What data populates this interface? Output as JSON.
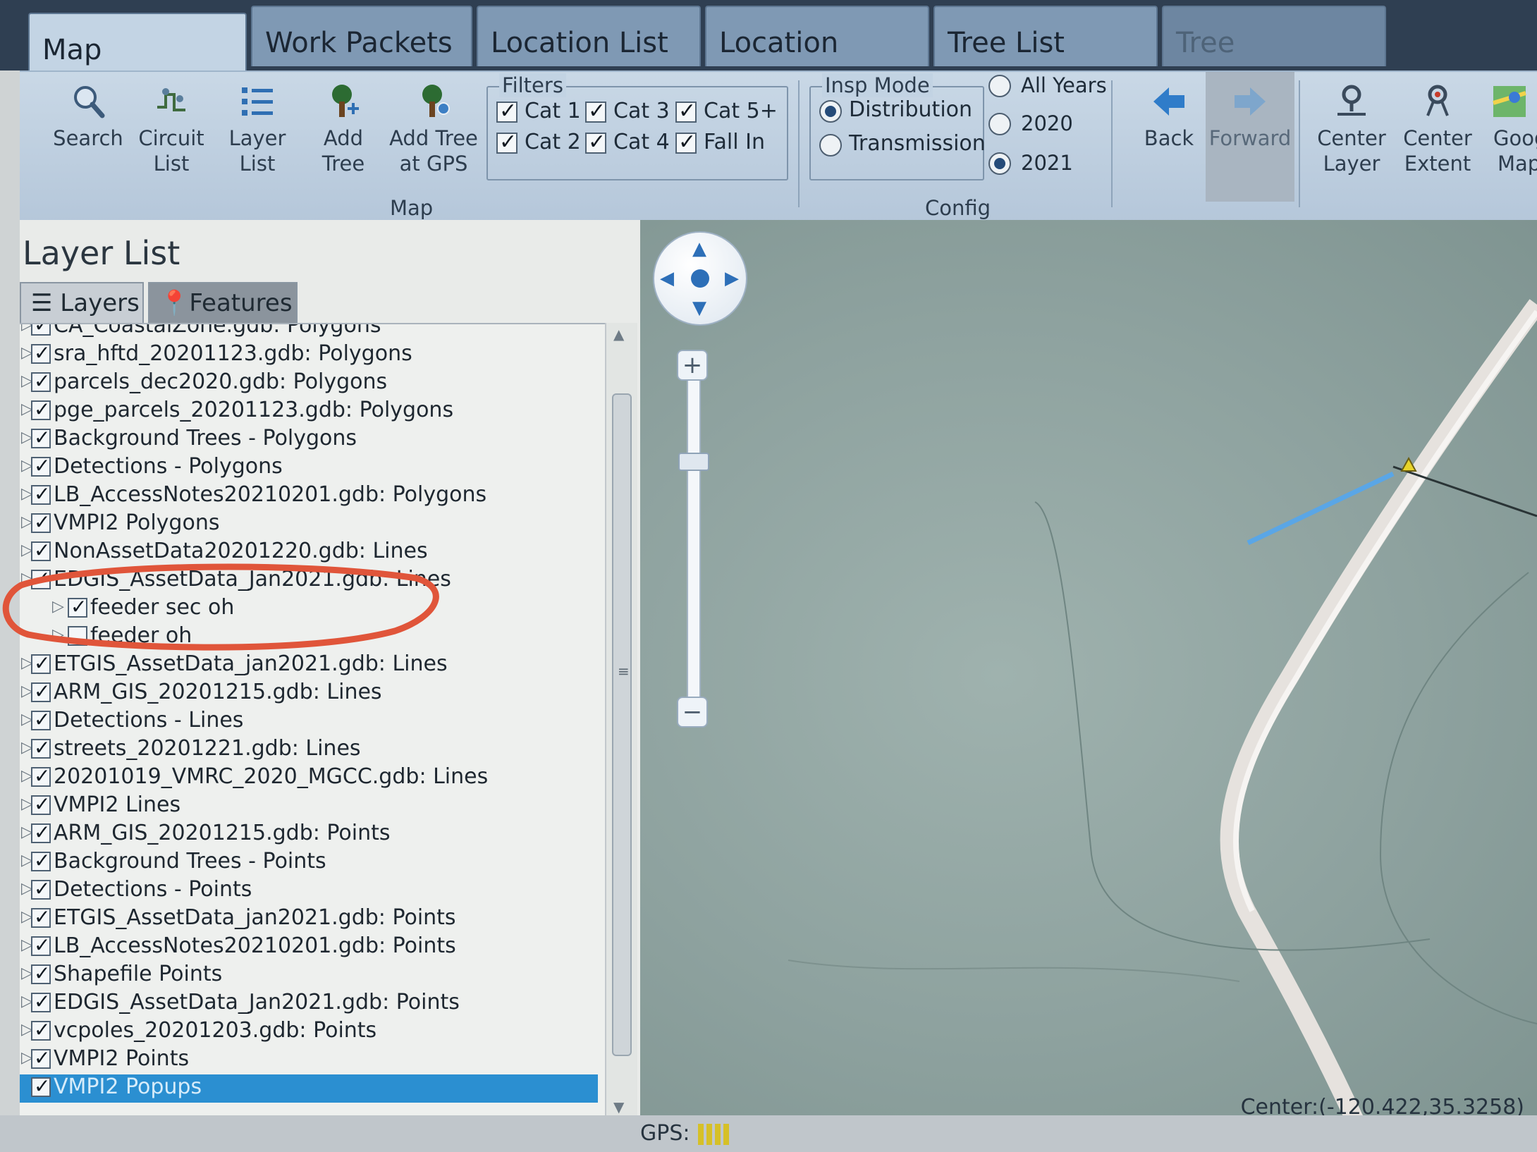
{
  "tabs": [
    "Map",
    "Work Packets",
    "Location List",
    "Location",
    "Tree List",
    "Tree"
  ],
  "ribbon": {
    "buttons": [
      {
        "name": "search",
        "label1": "Search",
        "label2": ""
      },
      {
        "name": "circuit-list",
        "label1": "Circuit",
        "label2": "List"
      },
      {
        "name": "layer-list",
        "label1": "Layer",
        "label2": "List"
      },
      {
        "name": "add-tree",
        "label1": "Add",
        "label2": "Tree"
      },
      {
        "name": "add-tree-gps",
        "label1": "Add Tree",
        "label2": "at GPS"
      }
    ],
    "map_group_label": "Map",
    "filters": {
      "legend": "Filters",
      "items": [
        {
          "label": "Cat 1",
          "checked": true
        },
        {
          "label": "Cat 3",
          "checked": true
        },
        {
          "label": "Cat 5+",
          "checked": true
        },
        {
          "label": "Cat 2",
          "checked": true
        },
        {
          "label": "Cat 4",
          "checked": true
        },
        {
          "label": "Fall In",
          "checked": true
        }
      ]
    },
    "insp_mode": {
      "legend": "Insp Mode",
      "options": [
        {
          "label": "Distribution",
          "selected": true
        },
        {
          "label": "Transmission",
          "selected": false
        }
      ]
    },
    "years": [
      {
        "label": "All Years",
        "selected": false
      },
      {
        "label": "2020",
        "selected": false
      },
      {
        "label": "2021",
        "selected": true
      }
    ],
    "config_label": "Config",
    "nav": {
      "back": "Back",
      "forward": "Forward",
      "center_layer1": "Center",
      "center_layer2": "Layer",
      "center_extent1": "Center",
      "center_extent2": "Extent",
      "google1": "Goog",
      "google2": "Map"
    }
  },
  "layer_panel": {
    "title": "Layer List",
    "tab_layers": "Layers",
    "tab_features": "Features",
    "rows": [
      {
        "label": "CA_CoastalZone.gdb: Polygons",
        "checked": true,
        "indent": 0,
        "expander": true,
        "selected": false
      },
      {
        "label": "sra_hftd_20201123.gdb: Polygons",
        "checked": true,
        "indent": 0,
        "expander": true,
        "selected": false
      },
      {
        "label": "parcels_dec2020.gdb: Polygons",
        "checked": true,
        "indent": 0,
        "expander": true,
        "selected": false
      },
      {
        "label": "pge_parcels_20201123.gdb: Polygons",
        "checked": true,
        "indent": 0,
        "expander": true,
        "selected": false
      },
      {
        "label": "Background Trees - Polygons",
        "checked": true,
        "indent": 0,
        "expander": true,
        "selected": false
      },
      {
        "label": "Detections - Polygons",
        "checked": true,
        "indent": 0,
        "expander": true,
        "selected": false
      },
      {
        "label": "LB_AccessNotes20210201.gdb: Polygons",
        "checked": true,
        "indent": 0,
        "expander": true,
        "selected": false
      },
      {
        "label": "VMPI2 Polygons",
        "checked": true,
        "indent": 0,
        "expander": true,
        "selected": false
      },
      {
        "label": "NonAssetData20201220.gdb: Lines",
        "checked": true,
        "indent": 0,
        "expander": true,
        "selected": false
      },
      {
        "label": "EDGIS_AssetData_Jan2021.gdb: Lines",
        "checked": true,
        "indent": 0,
        "expander": true,
        "selected": false
      },
      {
        "label": "feeder sec oh",
        "checked": true,
        "indent": 1,
        "expander": true,
        "selected": false
      },
      {
        "label": "feeder oh",
        "checked": false,
        "indent": 1,
        "expander": true,
        "selected": false
      },
      {
        "label": "ETGIS_AssetData_jan2021.gdb: Lines",
        "checked": true,
        "indent": 0,
        "expander": true,
        "selected": false
      },
      {
        "label": "ARM_GIS_20201215.gdb: Lines",
        "checked": true,
        "indent": 0,
        "expander": true,
        "selected": false
      },
      {
        "label": "Detections - Lines",
        "checked": true,
        "indent": 0,
        "expander": true,
        "selected": false
      },
      {
        "label": "streets_20201221.gdb: Lines",
        "checked": true,
        "indent": 0,
        "expander": true,
        "selected": false
      },
      {
        "label": "20201019_VMRC_2020_MGCC.gdb: Lines",
        "checked": true,
        "indent": 0,
        "expander": true,
        "selected": false
      },
      {
        "label": "VMPI2 Lines",
        "checked": true,
        "indent": 0,
        "expander": true,
        "selected": false
      },
      {
        "label": "ARM_GIS_20201215.gdb: Points",
        "checked": true,
        "indent": 0,
        "expander": true,
        "selected": false
      },
      {
        "label": "Background Trees - Points",
        "checked": true,
        "indent": 0,
        "expander": true,
        "selected": false
      },
      {
        "label": "Detections - Points",
        "checked": true,
        "indent": 0,
        "expander": true,
        "selected": false
      },
      {
        "label": "ETGIS_AssetData_jan2021.gdb: Points",
        "checked": true,
        "indent": 0,
        "expander": true,
        "selected": false
      },
      {
        "label": "LB_AccessNotes20210201.gdb: Points",
        "checked": true,
        "indent": 0,
        "expander": true,
        "selected": false
      },
      {
        "label": "Shapefile Points",
        "checked": true,
        "indent": 0,
        "expander": true,
        "selected": false
      },
      {
        "label": "EDGIS_AssetData_Jan2021.gdb: Points",
        "checked": true,
        "indent": 0,
        "expander": true,
        "selected": false
      },
      {
        "label": "vcpoles_20201203.gdb: Points",
        "checked": true,
        "indent": 0,
        "expander": true,
        "selected": false
      },
      {
        "label": "VMPI2 Points",
        "checked": true,
        "indent": 0,
        "expander": true,
        "selected": false
      },
      {
        "label": "VMPI2 Popups",
        "checked": true,
        "indent": 0,
        "expander": false,
        "selected": true
      }
    ]
  },
  "map": {
    "center_text": "Center:(-120.422,35.3258)"
  },
  "status": {
    "gps_label": "GPS:"
  },
  "colors": {
    "accent": "#2b8fd1",
    "annotation": "#e0553a",
    "road": "#e6e2de",
    "feeder_line": "#5aa6e6"
  }
}
